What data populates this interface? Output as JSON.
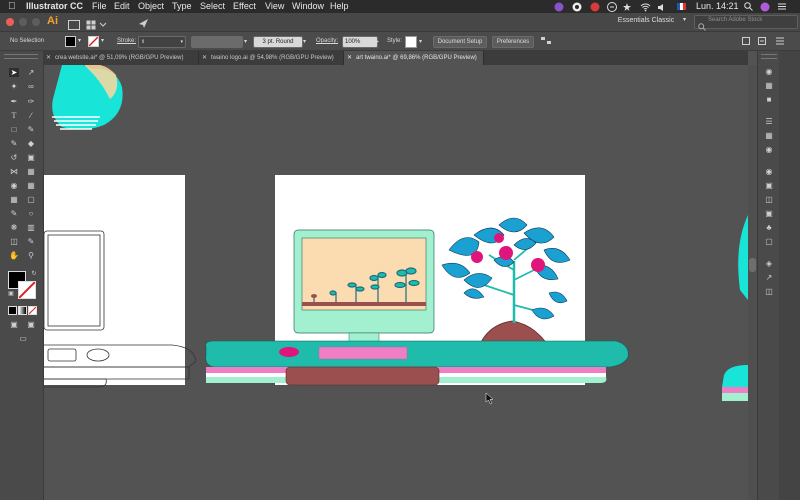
{
  "menubar": {
    "app_name": "Illustrator CC",
    "menus": [
      "File",
      "Edit",
      "Object",
      "Type",
      "Select",
      "Effect",
      "View",
      "Window",
      "Help"
    ],
    "clock": "Lun. 14:21"
  },
  "appbar": {
    "app_logo": "Ai",
    "workspace": "Essentials Classic",
    "search_placeholder": "Search Adobe Stock"
  },
  "control_bar": {
    "selection": "No Selection",
    "stroke_label": "Stroke:",
    "stroke_profile": "3 pt. Round",
    "opacity_label": "Opacity:",
    "opacity_value": "100%",
    "style_label": "Style:",
    "document_setup": "Document Setup",
    "preferences": "Preferences"
  },
  "tabs": [
    {
      "label": "crea website.ai* @ 51,09% (RGB/GPU Preview)"
    },
    {
      "label": "twaino logo.ai @ 54,98% (RGB/GPU Preview)"
    },
    {
      "label": "art twaino.ai* @ 69,86% (RGB/GPU Preview)"
    }
  ],
  "icons": {
    "apple": "apple-icon",
    "wifi": "wifi-icon",
    "search": "search-icon",
    "menu": "list-icon"
  },
  "colors": {
    "teal": "#1fbcac",
    "mint": "#a3f0d0",
    "pink": "#ef7ec5",
    "magenta": "#e0157b",
    "peach": "#fbdcb0",
    "brown": "#9b4f4f",
    "leaf_blue": "#1ba1d1",
    "cyan": "#18e5d8"
  }
}
